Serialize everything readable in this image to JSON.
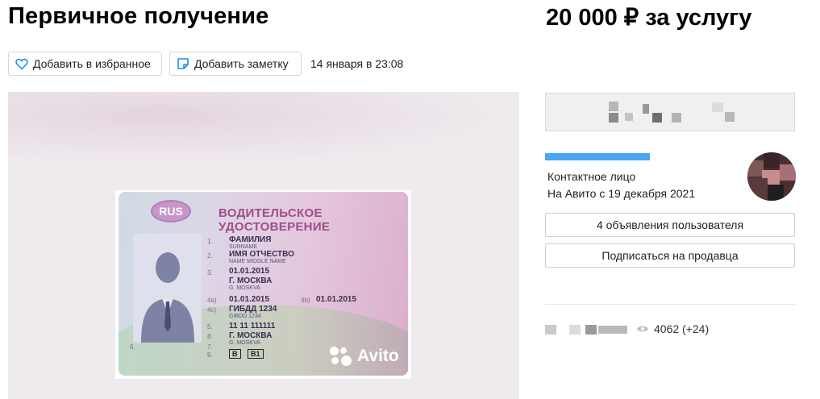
{
  "header": {
    "title": "Первичное получение",
    "price": "20 000 ₽ за услугу"
  },
  "actions": {
    "favorite_label": "Добавить в избранное",
    "note_label": "Добавить заметку",
    "published": "14 января в 23:08"
  },
  "card": {
    "country": "RUS",
    "doc_title": "ВОДИТЕЛЬСКОЕ УДОСТОВЕРЕНИЕ",
    "fields": [
      {
        "num": "1.",
        "main": "ФАМИЛИЯ",
        "sub": "SURNAME"
      },
      {
        "num": "2.",
        "main": "ИМЯ ОТЧЕСТВО",
        "sub": "NAME MIDDLE NAME"
      },
      {
        "num": "3.",
        "main": "01.01.2015",
        "sub": ""
      },
      {
        "num": "",
        "main": "Г. МОСКВА",
        "sub": "G. MOSKVA"
      },
      {
        "num": "4a)",
        "main": "01.01.2015",
        "sub": ""
      },
      {
        "num": "4c)",
        "main": "ГИБДД 1234",
        "sub": "GIBDD 1234"
      },
      {
        "num": "5.",
        "main": "11 11 111111",
        "sub": ""
      },
      {
        "num": "8.",
        "main": "Г. МОСКВА",
        "sub": "G. MOSKVA"
      }
    ],
    "field_4b": "01.01.2015",
    "num_4b": "4b)",
    "num_6": "6.",
    "num_7": "7.",
    "num_9": "9.",
    "categories": [
      "B",
      "B1"
    ],
    "watermark": "Avito"
  },
  "seller": {
    "type": "Контактное лицо",
    "since": "На Авито с 19 декабря 2021",
    "listings_label": "4 объявления пользователя",
    "subscribe_label": "Подписаться на продавца"
  },
  "stats": {
    "views": "4062 (+24)"
  },
  "colors": {
    "link_blue": "#49a6f2",
    "pink_title": "#a14c8c"
  }
}
